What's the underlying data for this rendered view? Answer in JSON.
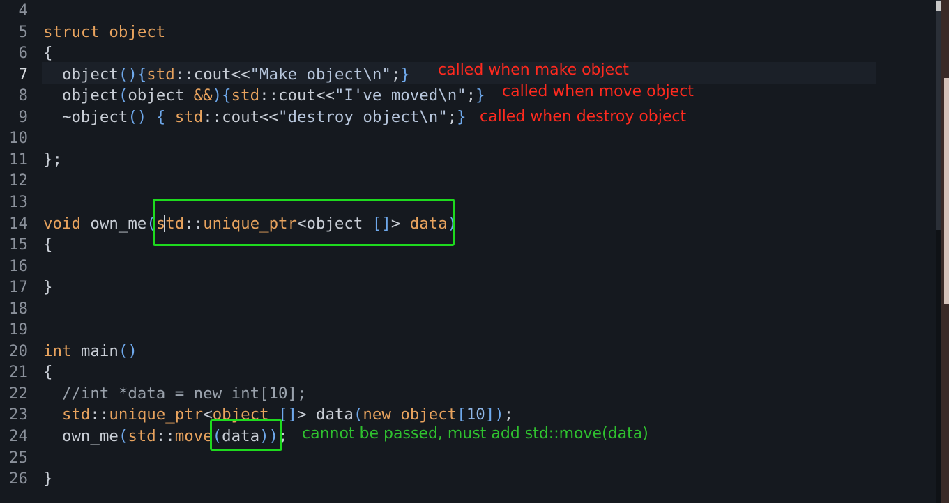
{
  "editor": {
    "lines": [
      {
        "number": "4",
        "parts": []
      },
      {
        "number": "5",
        "parts": [
          [
            "kw",
            "struct"
          ],
          [
            "pl",
            " "
          ],
          [
            "kw",
            "object"
          ]
        ]
      },
      {
        "number": "6",
        "parts": [
          [
            "pl",
            "{"
          ]
        ]
      },
      {
        "number": "7",
        "parts": [
          [
            "pl",
            "  object"
          ],
          [
            "br",
            "(){"
          ],
          [
            "ns",
            "std"
          ],
          [
            "pl",
            "::cout<<"
          ],
          [
            "str",
            "\"Make object\\n\""
          ],
          [
            "pl",
            ";"
          ],
          [
            "br",
            "}"
          ]
        ]
      },
      {
        "number": "8",
        "parts": [
          [
            "pl",
            "  object"
          ],
          [
            "br",
            "("
          ],
          [
            "pl",
            "object "
          ],
          [
            "kw",
            "&&"
          ],
          [
            "br",
            "){"
          ],
          [
            "ns",
            "std"
          ],
          [
            "pl",
            "::cout<<"
          ],
          [
            "str",
            "\"I've moved\\n\""
          ],
          [
            "pl",
            ";"
          ],
          [
            "br",
            "}"
          ]
        ]
      },
      {
        "number": "9",
        "parts": [
          [
            "pl",
            "  ~object"
          ],
          [
            "br",
            "() { "
          ],
          [
            "ns",
            "std"
          ],
          [
            "pl",
            "::cout<<"
          ],
          [
            "str",
            "\"destroy object\\n\""
          ],
          [
            "pl",
            ";"
          ],
          [
            "br",
            "}"
          ]
        ]
      },
      {
        "number": "10",
        "parts": []
      },
      {
        "number": "11",
        "parts": [
          [
            "pl",
            "};"
          ]
        ]
      },
      {
        "number": "12",
        "parts": []
      },
      {
        "number": "13",
        "parts": []
      },
      {
        "number": "14",
        "parts": [
          [
            "kw",
            "void"
          ],
          [
            "pl",
            " own_me"
          ],
          [
            "br",
            "("
          ],
          [
            "ns",
            "std"
          ],
          [
            "pl",
            "::"
          ],
          [
            "ns",
            "unique_ptr"
          ],
          [
            "pl",
            "<object "
          ],
          [
            "br",
            "[]"
          ],
          [
            "pl",
            "> "
          ],
          [
            "ns",
            "data"
          ],
          [
            "br",
            ")"
          ]
        ]
      },
      {
        "number": "15",
        "parts": [
          [
            "pl",
            "{"
          ]
        ]
      },
      {
        "number": "16",
        "parts": []
      },
      {
        "number": "17",
        "parts": [
          [
            "pl",
            "}"
          ]
        ]
      },
      {
        "number": "18",
        "parts": []
      },
      {
        "number": "19",
        "parts": []
      },
      {
        "number": "20",
        "parts": [
          [
            "kw",
            "int"
          ],
          [
            "pl",
            " main"
          ],
          [
            "br",
            "()"
          ]
        ]
      },
      {
        "number": "21",
        "parts": [
          [
            "pl",
            "{"
          ]
        ]
      },
      {
        "number": "22",
        "parts": [
          [
            "cm",
            "  //int *data = new int[10];"
          ]
        ]
      },
      {
        "number": "23",
        "parts": [
          [
            "pl",
            "  "
          ],
          [
            "ns",
            "std"
          ],
          [
            "pl",
            "::"
          ],
          [
            "ns",
            "unique_ptr"
          ],
          [
            "pl",
            "<"
          ],
          [
            "ns",
            "object"
          ],
          [
            "pl",
            " "
          ],
          [
            "br",
            "[]"
          ],
          [
            "pl",
            "> data"
          ],
          [
            "br",
            "("
          ],
          [
            "kw",
            "new"
          ],
          [
            "pl",
            " "
          ],
          [
            "kw",
            "object"
          ],
          [
            "br",
            "["
          ],
          [
            "num",
            "10"
          ],
          [
            "br",
            "])"
          ],
          [
            "pl",
            ";"
          ]
        ]
      },
      {
        "number": "24",
        "parts": [
          [
            "pl",
            "  own_me"
          ],
          [
            "br",
            "("
          ],
          [
            "ns",
            "std"
          ],
          [
            "pl",
            "::"
          ],
          [
            "ns",
            "move"
          ],
          [
            "br",
            "("
          ],
          [
            "pl",
            "data"
          ],
          [
            "br",
            "))"
          ],
          [
            "pl",
            ";"
          ]
        ]
      },
      {
        "number": "25",
        "parts": []
      },
      {
        "number": "26",
        "parts": [
          [
            "pl",
            "}"
          ]
        ]
      }
    ],
    "active_line": "7"
  },
  "annotations": {
    "make": "called when make object",
    "move": "called when move object",
    "destroy": "called when destroy object",
    "cannot_pass": "cannot be passed, must add std::move(data)"
  },
  "colors": {
    "annotation_red": "#ff2a1f",
    "annotation_green": "#2fc12f",
    "highlight_box": "#1ed91e",
    "background": "#15191f"
  }
}
